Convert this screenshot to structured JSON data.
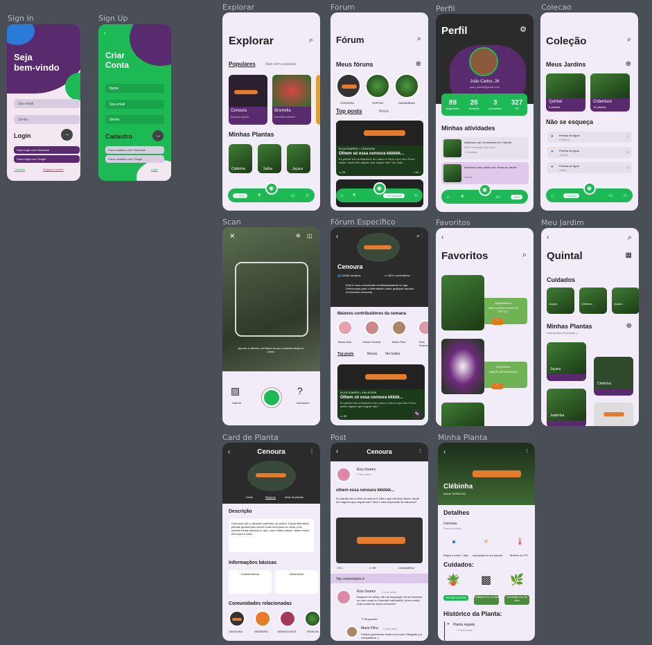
{
  "frames": {
    "signin": "Sign In",
    "signup": "Sign Up",
    "explorar": "Explorar",
    "forum": "Forum",
    "perfil": "Perfil",
    "colecao": "Colecao",
    "scan": "Scan",
    "forum_esp": "Fórum Específico",
    "favoritos": "Favoritos",
    "meujardim": "Meu Jardim",
    "cardplanta": "Card de Planta",
    "post": "Post",
    "minhaplanta": "Minha Planta"
  },
  "signin": {
    "title1": "Seja",
    "title2": "bem-vindo",
    "email": "Seu email",
    "senha": "Senha",
    "login": "Login",
    "fb": "Fazer login com Facebook",
    "google": "Fazer login com Google",
    "cadastro": "Cadastro",
    "esqueci": "Esqueci a senha"
  },
  "signup": {
    "back": "‹",
    "title1": "Criar",
    "title2": "Conta",
    "nome": "Nome",
    "email": "Seu email",
    "senha": "Senha",
    "cadastro": "Cadastro",
    "fb": "Fazer cadastro com Facebook",
    "google": "Fazer cadastro com Google",
    "login": "Login"
  },
  "explorar": {
    "title": "Explorar",
    "tab1": "Populares",
    "tab2": "Mais bem-avaliadas",
    "card1": "Cenoura",
    "card1s": "Daucus carota",
    "card2": "Bromélia",
    "card2s": "Bromélia vriesea",
    "sec": "Minhas Plantas",
    "p1": "Clebinha",
    "p2": "Safira",
    "p3": "Juçara",
    "nav_home": "Início"
  },
  "forum": {
    "title": "Fórum",
    "sec": "Meus fóruns",
    "f1": "CENOURA",
    "f2": "HORTAS",
    "f3": "SAMAMBAIA",
    "tab1": "Top posts",
    "tab2": "Novos",
    "meta": "ELZA SOARES > CENOURA",
    "post": "Olhem só essa cenoura kkkkkk...",
    "body": "Eu plantei ela na finalzinho do outono e olha o que deu! Ficou assim, ainda tem alguém que engole não? Ver mais",
    "c": "25",
    "v": "40",
    "nav": "Comunidade"
  },
  "perfil": {
    "title": "Perfil",
    "name": "João Carlos, 26",
    "email": "joao_carlos@gmail.com",
    "s1": "89",
    "l1": "seguidores",
    "s2": "26",
    "l2": "favoritos",
    "s3": "3",
    "l3": "conquistas",
    "s4": "327",
    "l4": "XP",
    "sec": "Minhas atividades",
    "a1": "Adicionou um Comentário em: Hortelã",
    "a1s": "Sim! Concordo com você.",
    "a1t": "• 2 h atrás",
    "a2": "Adicionou uma planta em: Horta do Jardim",
    "a2s": "Sálvia",
    "nav": "Perfil"
  },
  "colecao": {
    "title": "Coleção",
    "sec1": "Meus Jardins",
    "g1": "Quintal",
    "g1s": "3 plantas",
    "g2": "Cobertura",
    "g2s": "14 plantas",
    "sec2": "Não se esqueça",
    "r1": "Precisa de água",
    "r1s": "Clebinha",
    "r2": "Precisa de água",
    "r2s": "Juçara",
    "r3": "Precisa de água",
    "r3s": "Safira",
    "nav": "Coleção"
  },
  "scan": {
    "hint": "Aponte a câmera, certifique-se que a planta esteja no centro",
    "g": "Galeria",
    "i": "Instruções"
  },
  "forum_esp": {
    "title": "Cenoura",
    "members": "12426 usuários",
    "comments": "3831 comentários",
    "desc": "Esta é uma comunidade certificada/padrão do app. Direcionada para o intercâmbio sobre qualquer assunto envolvendo cenouras.",
    "sec": "Maiores contribuidores da semana",
    "u1": "Maria Julia",
    "u2": "Carlos Teixeira",
    "u3": "Mário Filho",
    "u4": "Elza Soares",
    "tab1": "Top posts",
    "tab2": "Novos",
    "tab3": "Ver todos",
    "meta": "ELZA SOARES • 14H ATRÁS",
    "post": "Olhem só essa cenoura kkkkk...",
    "body": "Eu plantei ela no finalzinho do outono e olha o que deu! Ficou assim alguém que engole não?",
    "c": "30"
  },
  "favoritos": {
    "title": "Favoritos",
    "f1": "SAMAMBAIA",
    "f1s": "UMA PLANTA CHEIA DE ESTILO",
    "f2": "ORQUÍDEA",
    "f2s": "UMA PLANTA BONITA"
  },
  "meujardim": {
    "title": "Quintal",
    "sec1": "Cuidados",
    "c1": "Juçara",
    "c2": "Clebinha",
    "c3": "Juçara",
    "sec2": "Minhas Plantas",
    "sub": "Você possui 05 plantas :)",
    "p1": "Juçara",
    "p2": "Clebinha",
    "p3": "Juabinha"
  },
  "cardplanta": {
    "title": "Cenoura",
    "t1": "Dicas",
    "t2": "Resumo",
    "t3": "Guia de plantio",
    "d": "Descrição",
    "dtext": "Cenouras são o alimento preferido do coelho. Essas diferentes plantas apresentam fazem muito bem para os olhos, pois contém muita vitamina A, que, como todos sabem, fazem muito bem para a vista.",
    "inf": "Informações básicas",
    "ib1": "Características",
    "ib2": "Dimensões",
    "com": "Comunidades relacionadas",
    "c1": "CENOURA",
    "c2": "ABÓBORA",
    "c3": "BATATA DOCE",
    "c4": "ERVILHA"
  },
  "post": {
    "title": "Cenoura",
    "user": "Elza Soares",
    "time": "3 dias atrás",
    "head": "olhem essa cenoura kkkkkk...",
    "body": "Eu plantei ela no final do outono e olha o que ela ficou assim, ainda tem alguém que engole não? Isso é uma expressão da natureza?",
    "v": "40",
    "c": "96",
    "share": "Compartilhar",
    "top": "Top comentarios",
    "cu": "Elza Soares",
    "ct": "2 dias atrás",
    "ctext": "Esquece de avisar, não se esqueçam de se inscrever no meu canal no Youtube! elzinha458, lá tem muito mais conteúdo sobre cenouras!",
    "reply": "Responder",
    "r2": "Mario Filho",
    "r2t": "2 dias atrás",
    "r2text": "Fofuxa apendendo muito com você! Obrigado por compartilhar :)"
  },
  "minhaplanta": {
    "name": "Clébinha",
    "since": "desde 15/05/2022",
    "det": "Detalhes",
    "sp": "Cenoura",
    "sps": "Daucus carota",
    "w": "Regar a cada 7 dias",
    "sun": "exposição ao sol parcial",
    "temp": "Mínimo de 2ºC",
    "cui": "Cuidados:",
    "b1": "REGAR AGORA",
    "b2": "Fertilizar em 13 dias",
    "b3": "Consultar em 18 dias",
    "hist": "Histórico da Planta:",
    "h1": "Planta regada",
    "h1s": "• 3 dias atrás"
  }
}
